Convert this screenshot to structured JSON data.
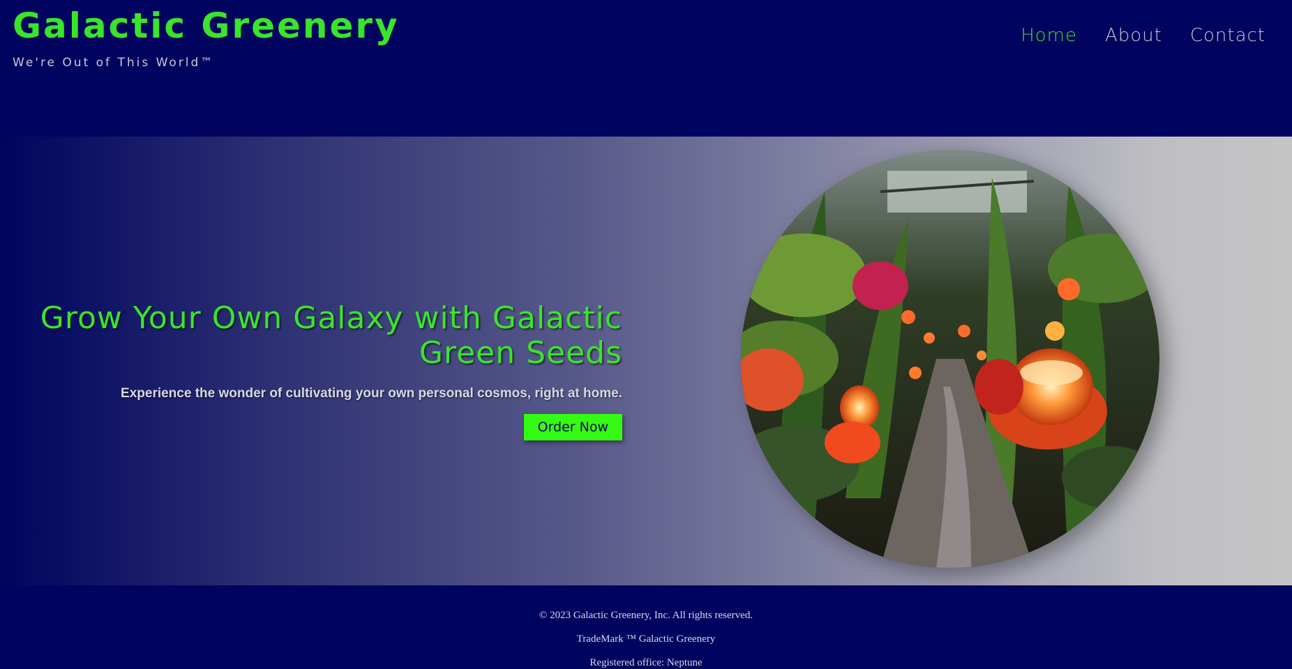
{
  "header": {
    "title": "Galactic Greenery",
    "tagline": "We're Out of This World™"
  },
  "nav": {
    "items": [
      {
        "label": "Home",
        "active": true
      },
      {
        "label": "About",
        "active": false
      },
      {
        "label": "Contact",
        "active": false
      }
    ]
  },
  "hero": {
    "heading": "Grow Your Own Galaxy with Galactic Green Seeds",
    "subtext": "Experience the wonder of cultivating your own personal cosmos, right at home.",
    "cta_label": "Order Now"
  },
  "footer": {
    "copyright": "© 2023 Galactic Greenery, Inc. All rights reserved.",
    "trademark": "TradeMark ™ Galactic Greenery",
    "office": "Registered office: Neptune"
  },
  "colors": {
    "brand_green": "#39e52a",
    "button_green": "#35fb12",
    "navy": "#00045e"
  }
}
